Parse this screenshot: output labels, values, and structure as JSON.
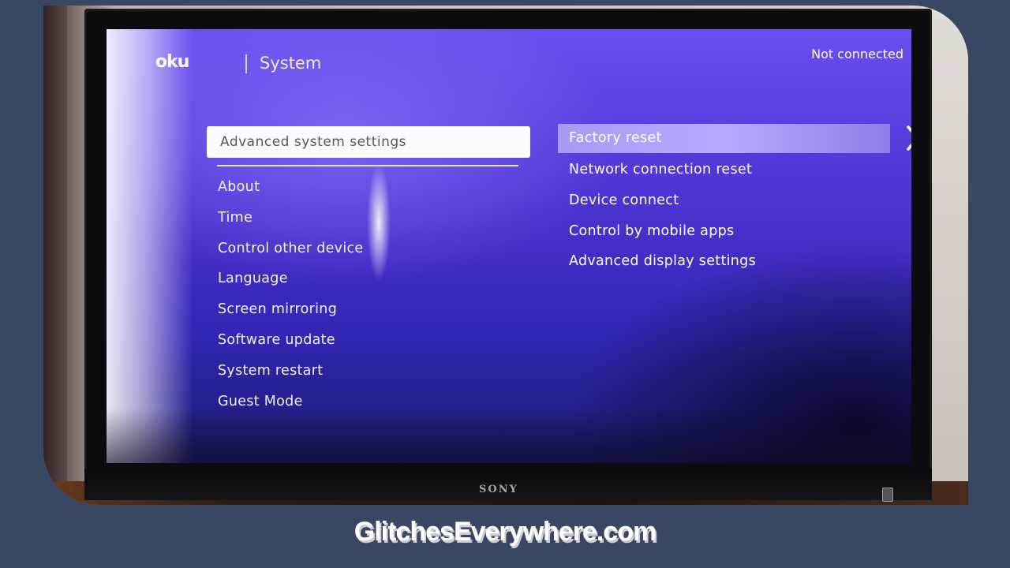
{
  "screen": {
    "logo_text": "oku",
    "title": "System",
    "status": "Not connected",
    "left_menu": {
      "selected": "Advanced system settings",
      "items": [
        {
          "label": "About"
        },
        {
          "label": "Time"
        },
        {
          "label": "Control other device"
        },
        {
          "label": "Language"
        },
        {
          "label": "Screen mirroring"
        },
        {
          "label": "Software update"
        },
        {
          "label": "System restart"
        },
        {
          "label": "Guest Mode"
        }
      ]
    },
    "right_menu": {
      "selected": "Factory reset",
      "items": [
        {
          "label": "Network connection reset"
        },
        {
          "label": "Device connect"
        },
        {
          "label": "Control by mobile apps"
        },
        {
          "label": "Advanced display settings"
        }
      ],
      "chevron_icon": "chevron-right-icon"
    }
  },
  "tv": {
    "brand": "SONY"
  },
  "watermark": "GlitchesEverywhere.com",
  "colors": {
    "page_background": "#3a4762",
    "screen_accent": "#5a3ee6",
    "highlight": "#b7aaff"
  }
}
